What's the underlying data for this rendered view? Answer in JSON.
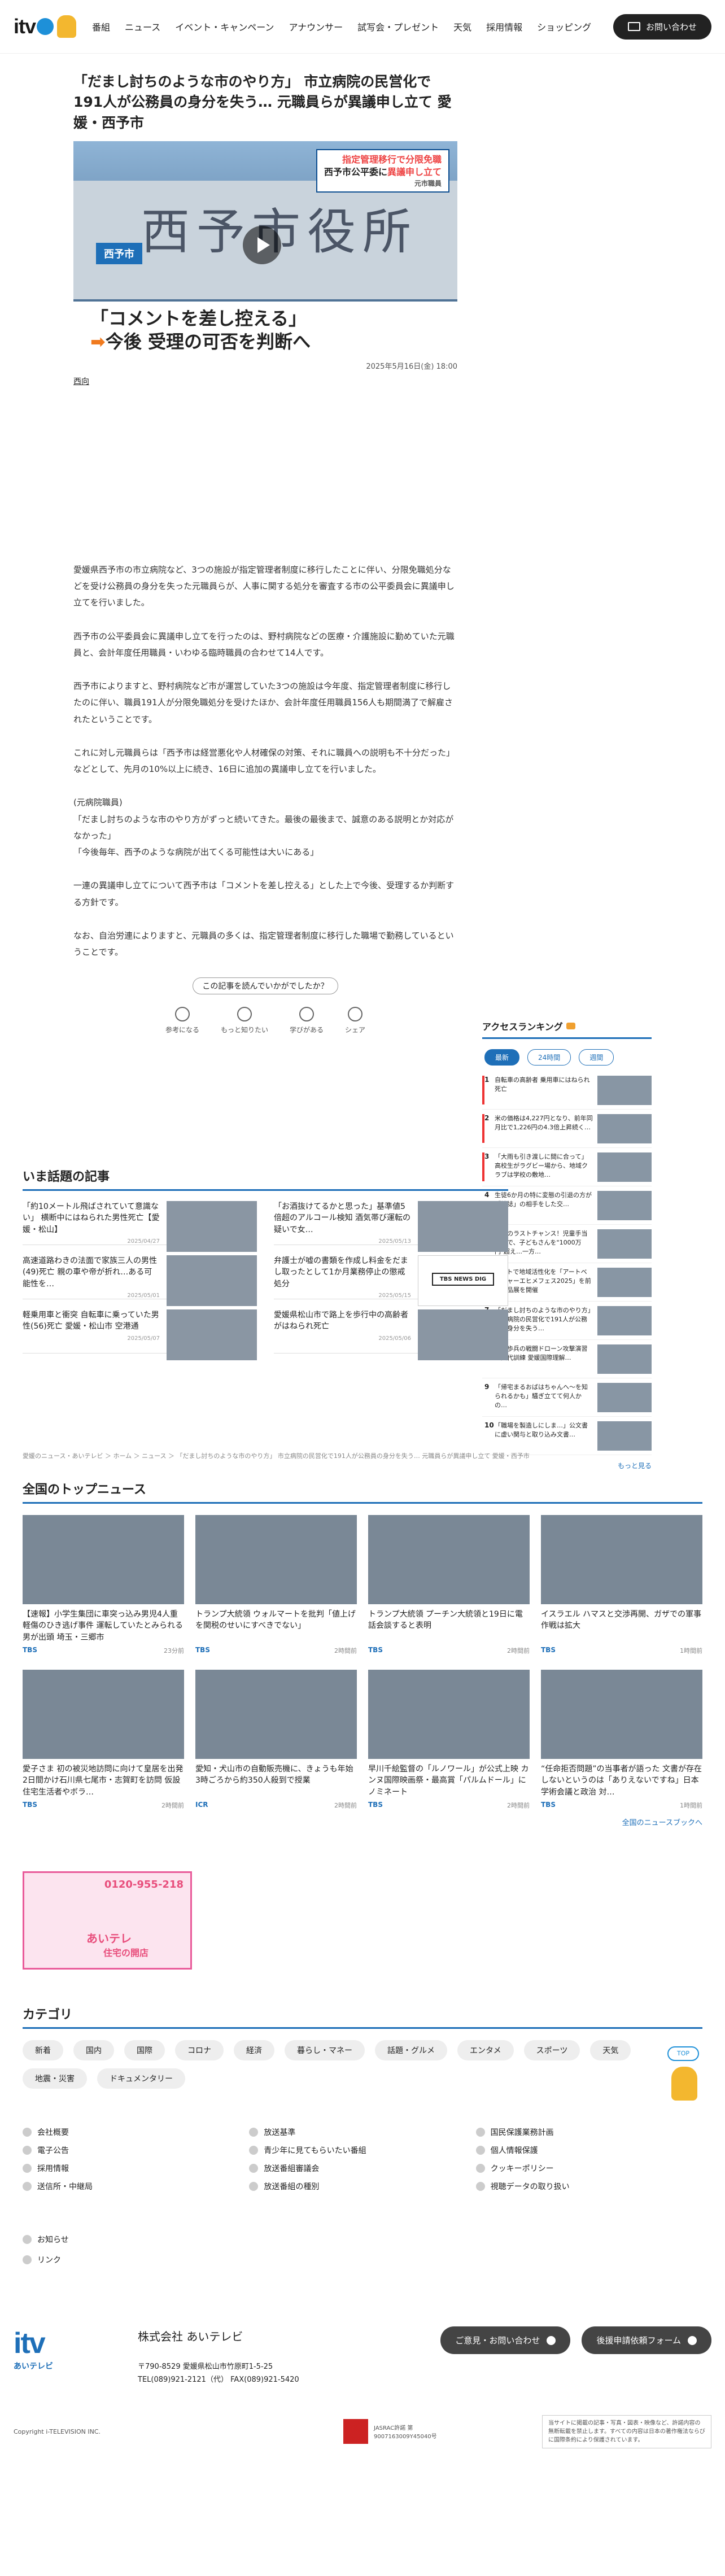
{
  "header": {
    "logo_text": "itv",
    "logo_sub": "あいテレビ",
    "nav": [
      "番組",
      "ニュース",
      "イベント・キャンペーン",
      "アナウンサー",
      "試写会・プレゼント",
      "天気",
      "採用情報",
      "ショッピング"
    ],
    "contact": "お問い合わせ"
  },
  "article": {
    "title": "「だまし討ちのような市のやり方」 市立病院の民営化で191人が公務員の身分を失う… 元職員らが異議申し立て 愛媛・西予市",
    "hero": {
      "building_text": "西予市役所",
      "badge": "西予市",
      "tag_line1a": "指定管理移行で",
      "tag_line1b": "分限免職",
      "tag_line2a": "西予市公平委に",
      "tag_line2b": "異議申し立て",
      "tag_line3": "元市職員",
      "cap_line1": "「コメントを差し控える」",
      "cap_arrow": "➡",
      "cap_line2": "今後 受理の可否を判断へ"
    },
    "date": "2025年5月16日(金) 18:00",
    "area": "西向",
    "paragraphs": [
      "愛媛県西予市の市立病院など、3つの施設が指定管理者制度に移行したことに伴い、分限免職処分などを受け公務員の身分を失った元職員らが、人事に関する処分を審査する市の公平委員会に異議申し立てを行いました。",
      "西予市の公平委員会に異議申し立てを行ったのは、野村病院などの医療・介護施設に勤めていた元職員と、会計年度任用職員・いわゆる臨時職員の合わせて14人です。",
      "西予市によりますと、野村病院など市が運営していた3つの施設は今年度、指定管理者制度に移行したのに伴い、職員191人が分限免職処分を受けたほか、会計年度任用職員156人も期間満了で解雇されたということです。",
      "これに対し元職員らは「西予市は経営悪化や人材確保の対策、それに職員への説明も不十分だった」などとして、先月の10%以上に続き、16日に追加の異議申し立てを行いました。",
      "(元病院職員)\n「だまし討ちのような市のやり方がずっと続いてきた。最後の最後まで、誠意のある説明とか対応がなかった」\n「今後毎年、西予のような病院が出てくる可能性は大いにある」",
      "一連の異議申し立てについて西予市は「コメントを差し控える」とした上で今後、受理するか判断する方針です。",
      "なお、自治労連によりますと、元職員の多くは、指定管理者制度に移行した職場で勤務しているということです。"
    ],
    "reaction_q": "この記事を読んでいかがでしたか？",
    "reactions": [
      "参考になる",
      "もっと知りたい",
      "学びがある",
      "シェア"
    ]
  },
  "ranking": {
    "title": "アクセスランキング",
    "tabs": [
      "最新",
      "24時間",
      "週間"
    ],
    "items": [
      {
        "n": "1",
        "t": "自転車の高齢者 乗用車にはねられ死亡"
      },
      {
        "n": "2",
        "t": "米の価格は4,227円となり、前年同月比で1,226円の4.3倍上昇続く…"
      },
      {
        "n": "3",
        "t": "「大雨も引き渡しに間に合って」高校生がラグビー場から、地域クラブは学校の敷地…"
      },
      {
        "n": "4",
        "t": "生徒6か月の特に変態の引退の方が「雑誌」の相手をした交…"
      },
      {
        "n": "5",
        "t": "日本のラストチャンス！児童手当拡充で、子どもさんを\"1000万円\"超え…一方…"
      },
      {
        "n": "6",
        "t": "アートで地域活性化を「アートベンチャーエヒメフェス2025」を前に作品展を開催"
      },
      {
        "n": "7",
        "t": "「だまし討ちのような市のやり方」市立病院の民営化で191人が公務員の身分を失う…"
      },
      {
        "n": "8",
        "t": "戦車歩兵の戦闘ドローン攻撃演習で交代訓練 愛媛国際理解…"
      },
      {
        "n": "9",
        "t": "「帰宅まるおばはちゃんへ～を知られるかも」騒ぎ立てて何人かの…"
      },
      {
        "n": "10",
        "t": "「職場を製造しにしま…」公文書に虚い関与と取り込み文書…"
      }
    ],
    "more": "もっと見る"
  },
  "hot_news": {
    "title": "いま話題の記事",
    "items": [
      {
        "t": "「約10メートル飛ばされていて意識ない」 横断中にはねられた男性死亡【愛媛・松山】",
        "d": "2025/04/27"
      },
      {
        "t": "「お酒抜けてるかと思った」基準値5倍超のアルコール検知 酒気帯び運転の疑いで女…",
        "d": "2025/05/13"
      },
      {
        "t": "高速道路わきの法面で家族三人の男性(49)死亡 親の車や帝が折れ…ある可能性を…",
        "d": "2025/05/01"
      },
      {
        "t": "弁護士が嘘の書類を作成し料金をだまし取ったとして1か月業務停止の懲戒処分",
        "d": "2025/05/15"
      },
      {
        "t": "軽乗用車と衝突 自転車に乗っていた男性(56)死亡 愛媛・松山市 空港通",
        "d": "2025/05/07"
      },
      {
        "t": "愛媛県松山市で路上を歩行中の高齢者がはねられ死亡",
        "d": "2025/05/06"
      }
    ],
    "newsdig": "TBS NEWS DIG"
  },
  "breadcrumb": "愛媛のニュース・あいテレビ ＞ ホーム ＞ ニュース ＞ 「だまし討ちのような市のやり方」 市立病院の民営化で191人が公務員の身分を失う… 元職員らが異議申し立て 愛媛・西予市",
  "top_news": {
    "title": "全国のトップニュース",
    "items": [
      {
        "t": "【速報】小学生集団に車突っ込み男児4人重軽傷のひき逃げ事件 運転していたとみられる男が出頭 埼玉・三郷市",
        "s": "TBS",
        "d": "23分前"
      },
      {
        "t": "トランプ大統領 ウォルマートを批判「値上げを関税のせいにすべきでない」",
        "s": "TBS",
        "d": "2時間前"
      },
      {
        "t": "トランプ大統領 プーチン大統領と19日に電話会談すると表明",
        "s": "TBS",
        "d": "2時間前"
      },
      {
        "t": "イスラエル ハマスと交渉再開、ガザでの軍事作戦は拡大",
        "s": "TBS",
        "d": "1時間前"
      },
      {
        "t": "愛子さま 初の被災地訪問に向けて皇居を出発 2日間かけ石川県七尾市・志賀町を訪問 仮設住宅生活者やボラ…",
        "s": "TBS",
        "d": "2時間前"
      },
      {
        "t": "愛知・犬山市の自動販売機に、きょうも年始3時ごろから約350人殺到で授業",
        "s": "ICR",
        "d": "2時間前"
      },
      {
        "t": "早川千絵監督の「ルノワール」が公式上映 カンヌ国際映画祭・最高賞「パルムドール」にノミネート",
        "s": "TBS",
        "d": "2時間前"
      },
      {
        "t": "“任命拒否問題”の当事者が語った 文書が存在しないというのは「ありえないですね」日本学術会議と政治 対…",
        "s": "TBS",
        "d": "1時間前"
      }
    ],
    "more": "全国のニュースブックへ"
  },
  "banner": {
    "phone": "0120-955-218",
    "line1": "あいテレ",
    "line2": "住宅の開店"
  },
  "category": {
    "title": "カテゴリ",
    "pills": [
      "新着",
      "国内",
      "国際",
      "コロナ",
      "経済",
      "暮らし・マネー",
      "話題・グルメ",
      "エンタメ",
      "スポーツ",
      "天気",
      "地震・災害",
      "ドキュメンタリー"
    ]
  },
  "page_top": "TOP",
  "footer_links": [
    "会社概要",
    "放送基準",
    "国民保護業務計画",
    "電子公告",
    "青少年に見てもらいたい番組",
    "個人情報保護",
    "採用情報",
    "放送番組審議会",
    "クッキーポリシー",
    "送信所・中継局",
    "放送番組の種別",
    "視聴データの取り扱い"
  ],
  "footer_links2": [
    "お知らせ",
    "リンク"
  ],
  "footer": {
    "logo": "itv",
    "logo_sub": "あいテレビ",
    "name": "株式会社 あいテレビ",
    "postal": "〒790-8529 愛媛県松山市竹原町1-5-25",
    "tel": "TEL(089)921-2121（代） FAX(089)921-5420",
    "btn1": "ご意見・お問い合わせ",
    "btn2": "後援申請依頼フォーム",
    "copy": "Copyright i-TELEVISION INC.",
    "jasrac": "JASRAC許諾 第9007163009Y45040号",
    "notice": "当サイトに掲載の記事・写真・図表・映像など、許諾内容の無断転載を禁止します。すべての内容は日本の著作権法ならびに国際条約により保護されています。"
  },
  "colors": {
    "accent": "#1e6fb8",
    "logo_blue": "#1e90d8",
    "bird": "#f3b72f"
  }
}
